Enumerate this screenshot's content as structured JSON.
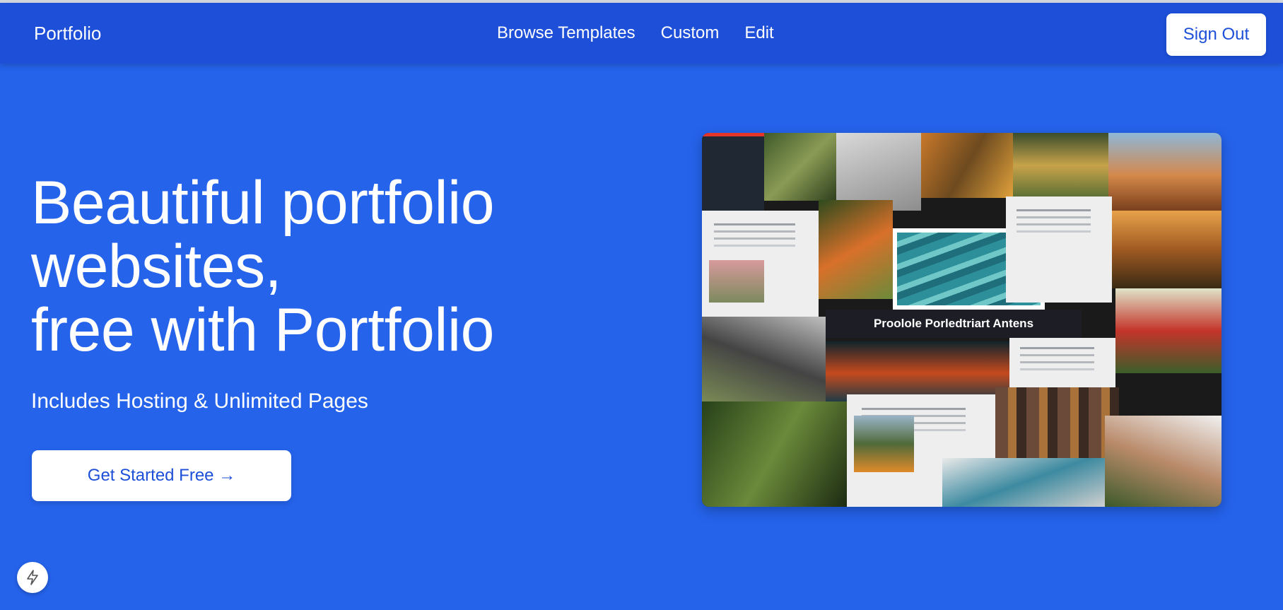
{
  "nav": {
    "brand": "Portfolio",
    "links": [
      "Browse Templates",
      "Custom",
      "Edit"
    ],
    "sign_out": "Sign Out"
  },
  "hero": {
    "title_lines": [
      "Beautiful portfolio",
      "websites,",
      "free with Portfolio"
    ],
    "subtitle": "Includes Hosting & Unlimited Pages",
    "cta": "Get Started Free →",
    "image_caption": "Proolole Porledtriart Antens"
  },
  "floating": {
    "icon": "lightning-icon"
  },
  "colors": {
    "background": "#2563eb",
    "navbar": "#1d4fd8",
    "button_text": "#1d4fd8",
    "white": "#ffffff"
  }
}
